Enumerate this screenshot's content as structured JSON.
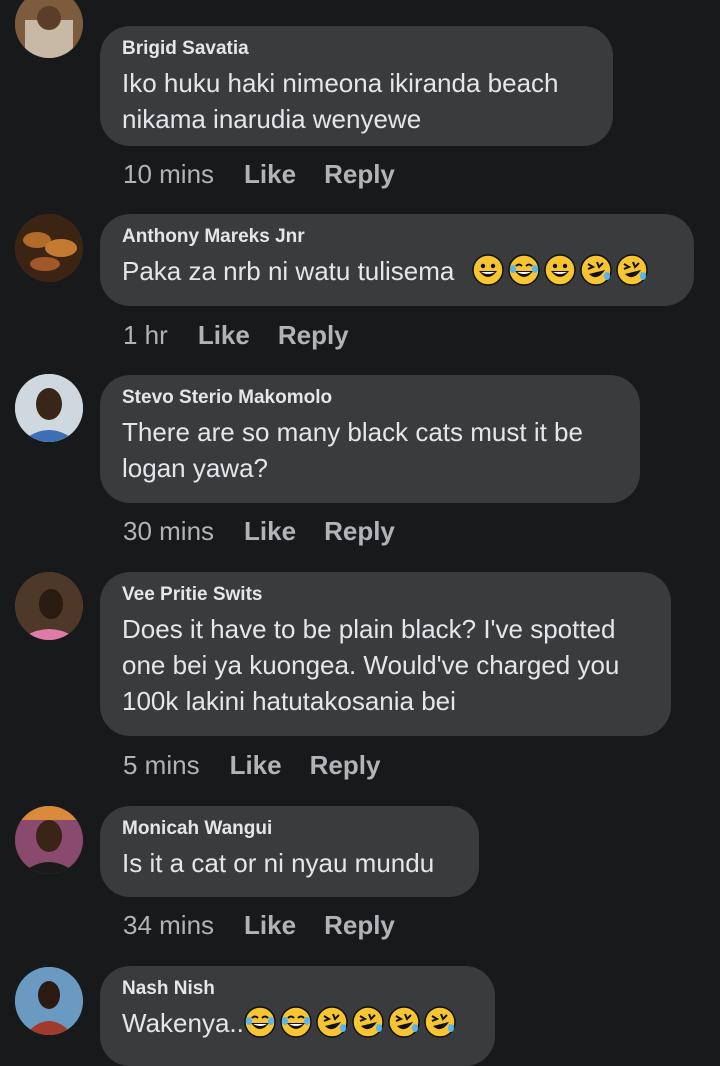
{
  "comments": [
    {
      "author": "Brigid Savatia",
      "text": "Iko huku haki nimeona ikiranda beach nikama inarudia wenyewe",
      "time": "10 mins",
      "like": "Like",
      "reply": "Reply",
      "avatar_icon": "profile-photo-icon"
    },
    {
      "author": "Anthony Mareks Jnr",
      "text": "Paka za nrb ni watu tulisema",
      "emojis": [
        "grinning-face",
        "face-with-tears-of-joy",
        "grinning-face",
        "rolling-on-floor-laughing",
        "rolling-on-floor-laughing"
      ],
      "time": "1 hr",
      "like": "Like",
      "reply": "Reply",
      "avatar_icon": "profile-photo-icon"
    },
    {
      "author": "Stevo Sterio Makomolo",
      "text": "There are so many black cats must it be logan yawa?",
      "time": "30 mins",
      "like": "Like",
      "reply": "Reply",
      "avatar_icon": "profile-photo-icon"
    },
    {
      "author": "Vee Pritie Swits",
      "text": "Does it have to be plain black? I've spotted one bei ya kuongea. Would've charged you 100k lakini hatutakosania bei",
      "time": "5 mins",
      "like": "Like",
      "reply": "Reply",
      "avatar_icon": "profile-photo-icon"
    },
    {
      "author": "Monicah Wangui",
      "text": "Is it a cat or ni nyau mundu",
      "time": "34 mins",
      "like": "Like",
      "reply": "Reply",
      "avatar_icon": "profile-photo-icon"
    },
    {
      "author": "Nash Nish",
      "text": "Wakenya..",
      "emojis": [
        "face-with-tears-of-joy",
        "face-with-tears-of-joy",
        "rolling-on-floor-laughing",
        "rolling-on-floor-laughing",
        "rolling-on-floor-laughing",
        "rolling-on-floor-laughing"
      ],
      "time": "",
      "like": "",
      "reply": "",
      "avatar_icon": "profile-photo-icon"
    }
  ],
  "colors": {
    "background": "#18191a",
    "bubble": "#3a3b3c",
    "text": "#e4e6eb",
    "secondary_text": "#b0b3b8",
    "emoji_yellow": "#f7c531"
  }
}
